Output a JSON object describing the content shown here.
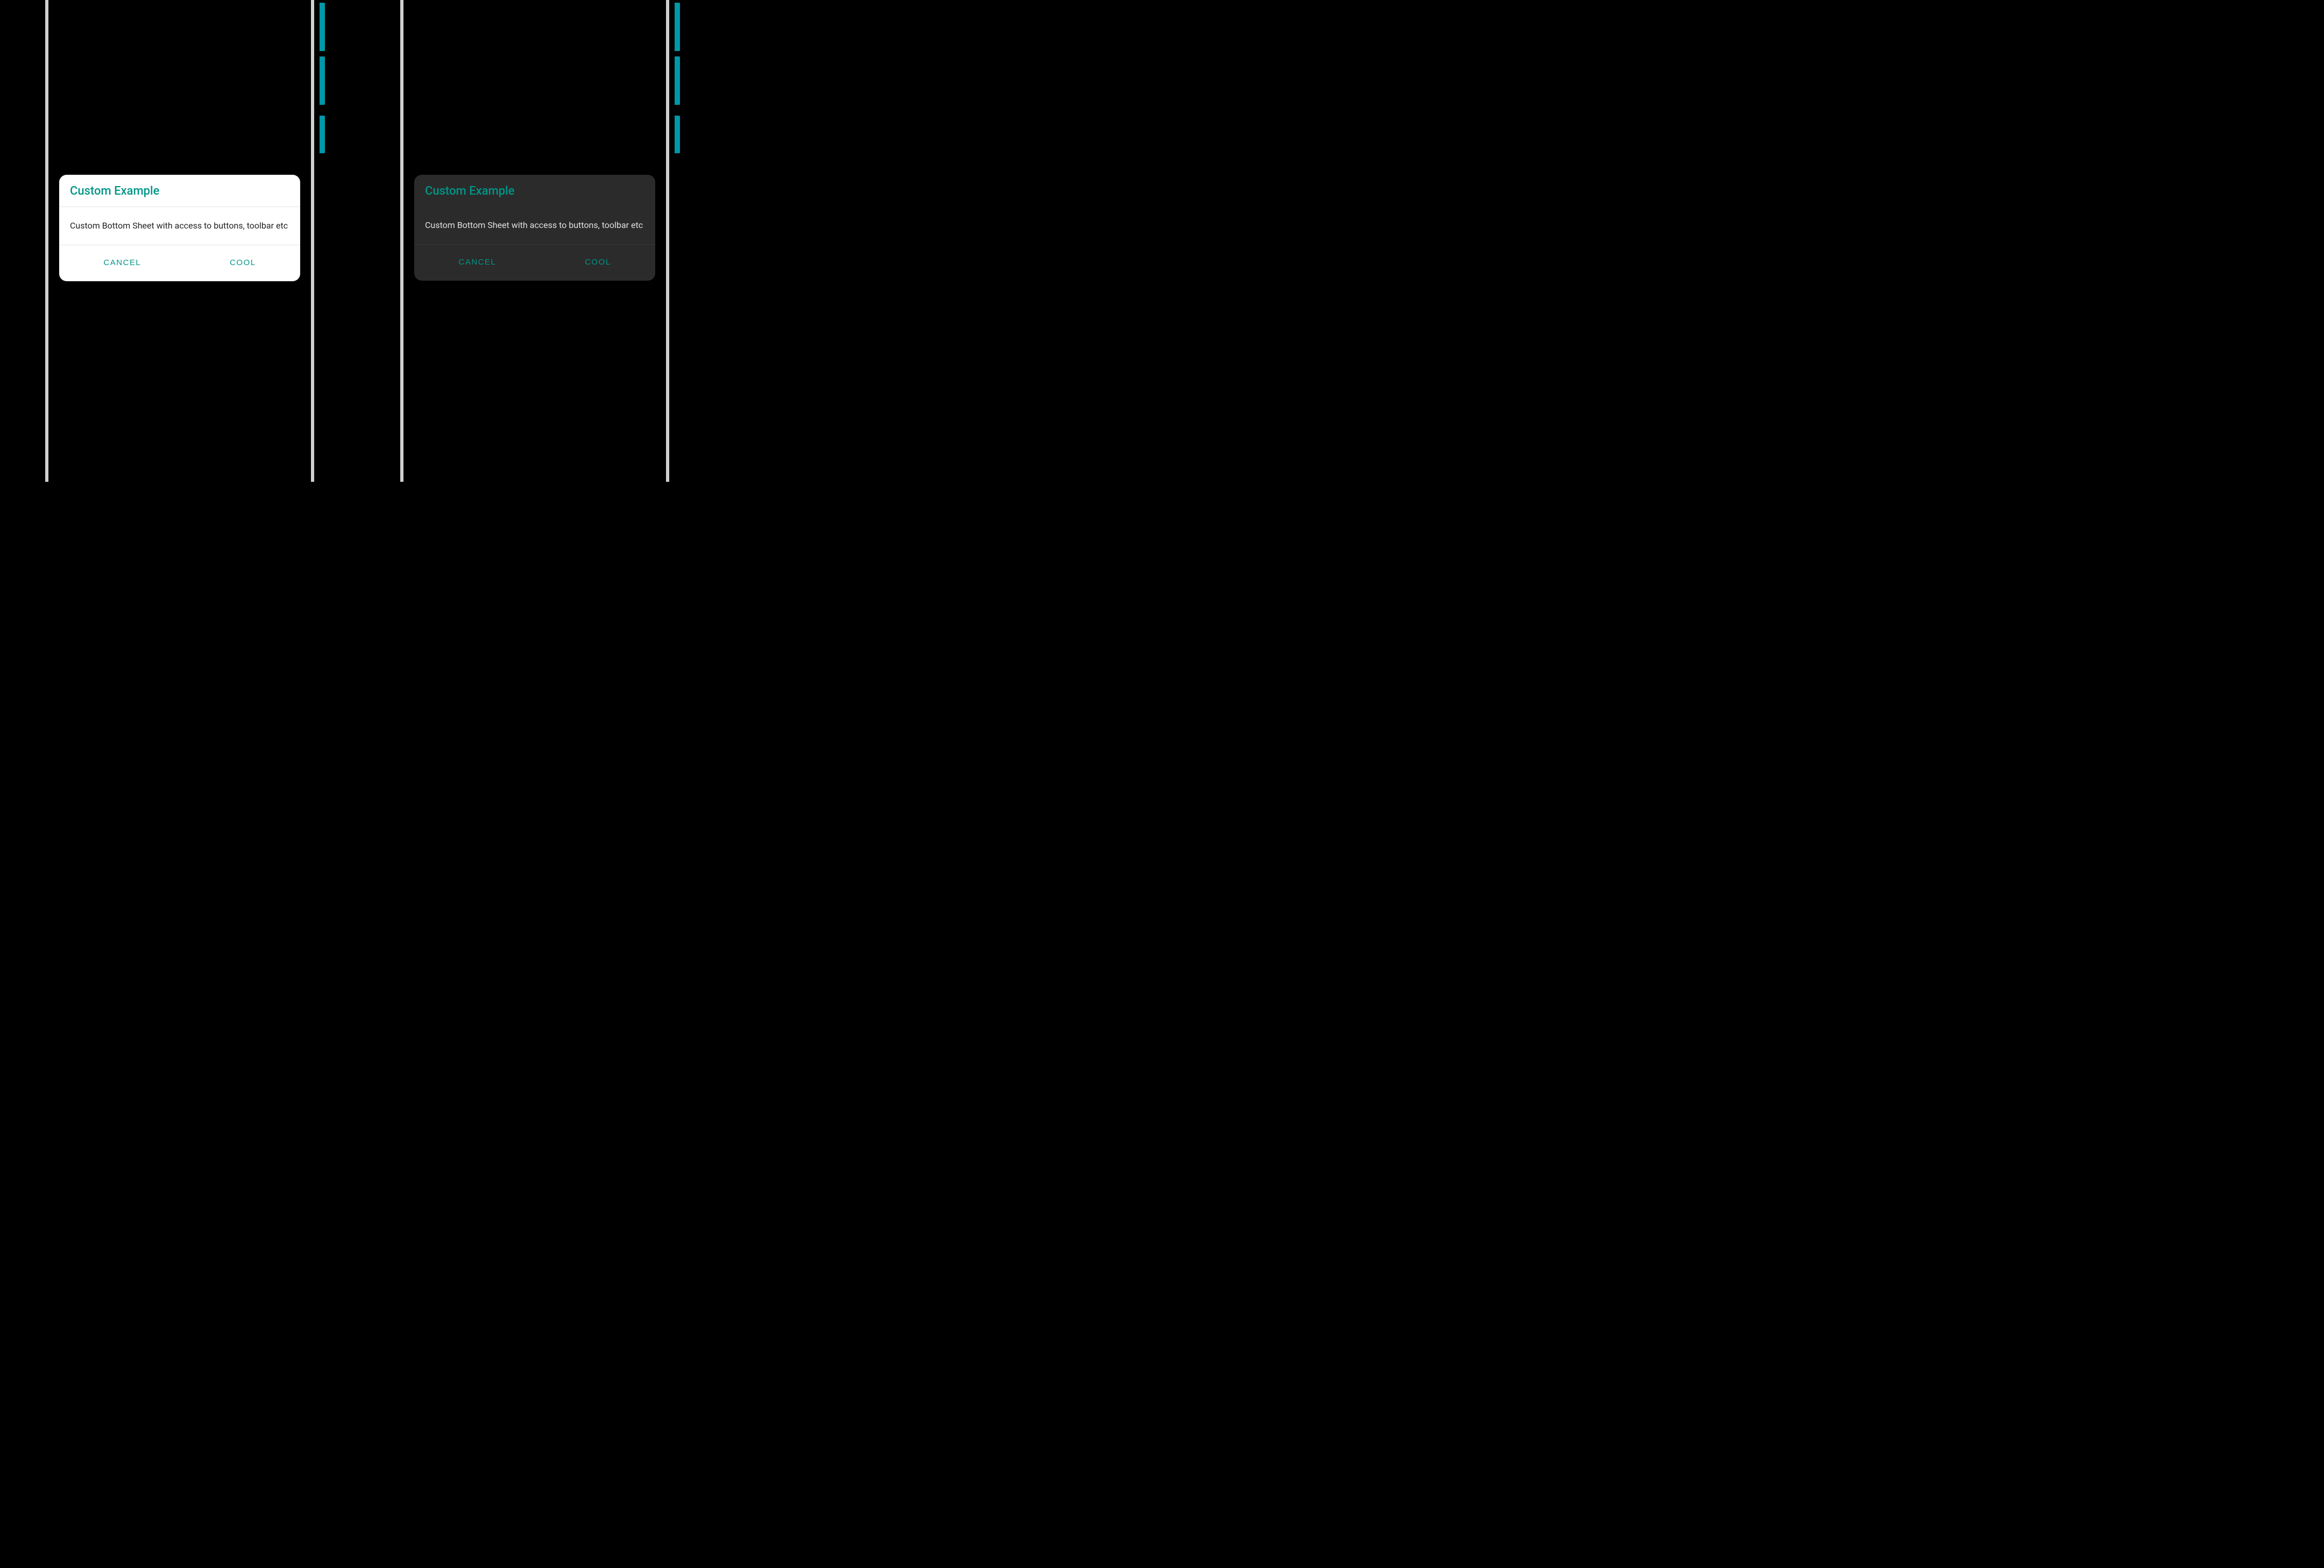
{
  "light": {
    "title": "Custom Example",
    "body": "Custom Bottom Sheet with access to buttons, toolbar etc",
    "cancel_label": "CANCEL",
    "confirm_label": "COOL"
  },
  "dark": {
    "title": "Custom Example",
    "body": "Custom Bottom Sheet with access to buttons, toolbar etc",
    "cancel_label": "CANCEL",
    "confirm_label": "COOL"
  },
  "colors": {
    "accent": "#009688",
    "light_bg": "#ffffff",
    "dark_bg": "#2b2b2b"
  }
}
